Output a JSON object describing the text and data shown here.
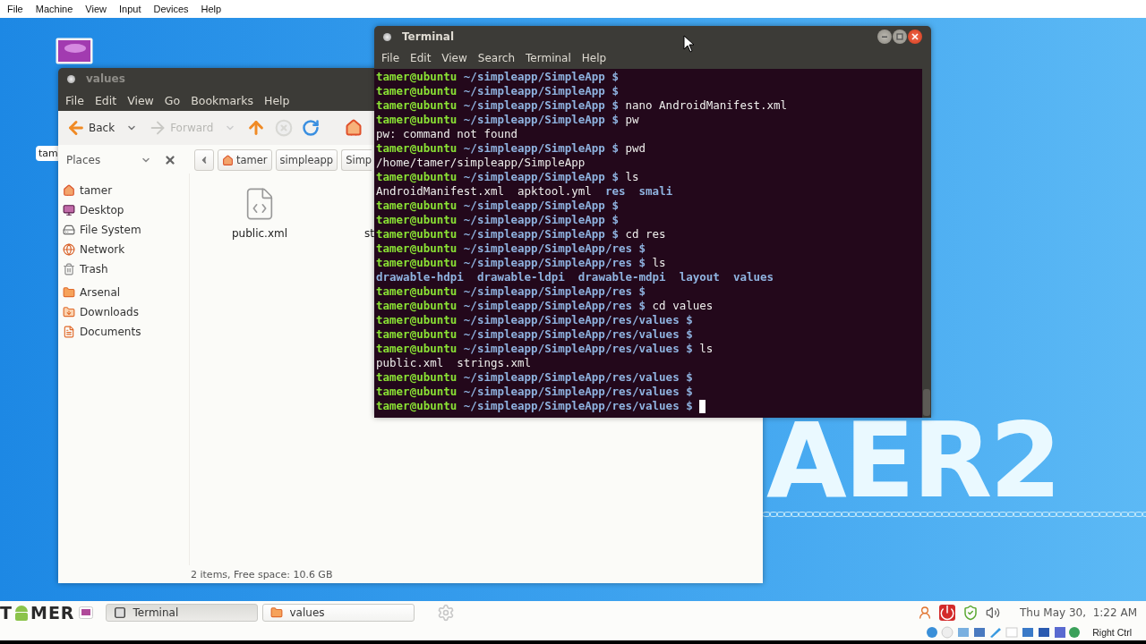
{
  "vm_menu": [
    "File",
    "Machine",
    "View",
    "Input",
    "Devices",
    "Help"
  ],
  "desktop": {
    "icons": [
      {
        "kind": "monitor"
      },
      {
        "kind": "label-only",
        "label": "tam"
      }
    ],
    "wallpaper_text": "AER2"
  },
  "file_manager": {
    "title": "values",
    "menu": [
      "File",
      "Edit",
      "View",
      "Go",
      "Bookmarks",
      "Help"
    ],
    "toolbar": [
      {
        "kind": "back",
        "label": "Back",
        "disabled": false,
        "menu": true
      },
      {
        "kind": "forward",
        "label": "Forward",
        "disabled": true,
        "menu": true
      },
      {
        "kind": "up",
        "disabled": false,
        "menu": false
      },
      {
        "kind": "stop",
        "disabled": true,
        "menu": false
      },
      {
        "kind": "reload",
        "disabled": false,
        "menu": false
      },
      {
        "kind": "home",
        "disabled": false,
        "menu": false
      }
    ],
    "location": {
      "pane": "Places",
      "crumbs": [
        {
          "label": "tamer",
          "kind": "home"
        },
        {
          "label": "simpleapp",
          "kind": "plain"
        },
        {
          "label": "Simp",
          "kind": "plain"
        }
      ]
    },
    "sidebar": {
      "places": [
        {
          "label": "tamer",
          "kind": "home"
        },
        {
          "label": "Desktop",
          "kind": "desktop"
        },
        {
          "label": "File System",
          "kind": "drive"
        },
        {
          "label": "Network",
          "kind": "network"
        },
        {
          "label": "Trash",
          "kind": "trash"
        }
      ],
      "bookmarks": [
        {
          "label": "Arsenal",
          "kind": "folder"
        },
        {
          "label": "Downloads",
          "kind": "downloads"
        },
        {
          "label": "Documents",
          "kind": "documents"
        }
      ]
    },
    "files": [
      {
        "name": "public.xml",
        "kind": "xml"
      },
      {
        "name": "st",
        "kind": "covered"
      }
    ],
    "status": "2 items, Free space: 10.6 GB"
  },
  "terminal": {
    "title": "Terminal",
    "menu": [
      "File",
      "Edit",
      "View",
      "Search",
      "Terminal",
      "Help"
    ],
    "cursor": true,
    "lines": [
      {
        "kind": "prompt",
        "user": "tamer@ubuntu",
        "path": "~/simpleapp/SimpleApp $"
      },
      {
        "kind": "prompt",
        "user": "tamer@ubuntu",
        "path": "~/simpleapp/SimpleApp $"
      },
      {
        "kind": "prompt",
        "user": "tamer@ubuntu",
        "path": "~/simpleapp/SimpleApp $",
        "command": "nano AndroidManifest.xml"
      },
      {
        "kind": "prompt",
        "user": "tamer@ubuntu",
        "path": "~/simpleapp/SimpleApp $",
        "command": "pw"
      },
      {
        "kind": "output",
        "items": [
          {
            "text": "pw: command not found",
            "dir": false
          }
        ]
      },
      {
        "kind": "prompt",
        "user": "tamer@ubuntu",
        "path": "~/simpleapp/SimpleApp $",
        "command": "pwd"
      },
      {
        "kind": "output",
        "items": [
          {
            "text": "/home/tamer/simpleapp/SimpleApp",
            "dir": false
          }
        ]
      },
      {
        "kind": "prompt",
        "user": "tamer@ubuntu",
        "path": "~/simpleapp/SimpleApp $",
        "command": "ls"
      },
      {
        "kind": "output",
        "items": [
          {
            "text": "AndroidManifest.xml",
            "dir": false
          },
          {
            "text": "apktool.yml",
            "dir": false
          },
          {
            "text": "res",
            "dir": true
          },
          {
            "text": "smali",
            "dir": true
          }
        ]
      },
      {
        "kind": "prompt",
        "user": "tamer@ubuntu",
        "path": "~/simpleapp/SimpleApp $"
      },
      {
        "kind": "prompt",
        "user": "tamer@ubuntu",
        "path": "~/simpleapp/SimpleApp $"
      },
      {
        "kind": "prompt",
        "user": "tamer@ubuntu",
        "path": "~/simpleapp/SimpleApp $",
        "command": "cd res"
      },
      {
        "kind": "prompt",
        "user": "tamer@ubuntu",
        "path": "~/simpleapp/SimpleApp/res $"
      },
      {
        "kind": "prompt",
        "user": "tamer@ubuntu",
        "path": "~/simpleapp/SimpleApp/res $",
        "command": "ls"
      },
      {
        "kind": "output",
        "items": [
          {
            "text": "drawable-hdpi",
            "dir": true
          },
          {
            "text": "drawable-ldpi",
            "dir": true
          },
          {
            "text": "drawable-mdpi",
            "dir": true
          },
          {
            "text": "layout",
            "dir": true
          },
          {
            "text": "values",
            "dir": true
          }
        ]
      },
      {
        "kind": "prompt",
        "user": "tamer@ubuntu",
        "path": "~/simpleapp/SimpleApp/res $"
      },
      {
        "kind": "prompt",
        "user": "tamer@ubuntu",
        "path": "~/simpleapp/SimpleApp/res $",
        "command": "cd values"
      },
      {
        "kind": "prompt",
        "user": "tamer@ubuntu",
        "path": "~/simpleapp/SimpleApp/res/values $"
      },
      {
        "kind": "prompt",
        "user": "tamer@ubuntu",
        "path": "~/simpleapp/SimpleApp/res/values $"
      },
      {
        "kind": "prompt",
        "user": "tamer@ubuntu",
        "path": "~/simpleapp/SimpleApp/res/values $",
        "command": "ls"
      },
      {
        "kind": "output",
        "items": [
          {
            "text": "public.xml",
            "dir": false
          },
          {
            "text": "strings.xml",
            "dir": false
          }
        ]
      },
      {
        "kind": "prompt",
        "user": "tamer@ubuntu",
        "path": "~/simpleapp/SimpleApp/res/values $"
      },
      {
        "kind": "prompt",
        "user": "tamer@ubuntu",
        "path": "~/simpleapp/SimpleApp/res/values $"
      },
      {
        "kind": "prompt",
        "user": "tamer@ubuntu",
        "path": "~/simpleapp/SimpleApp/res/values $"
      }
    ]
  },
  "taskbar": {
    "logo": [
      "T",
      "MER"
    ],
    "tasks": [
      {
        "label": "Terminal",
        "kind": "terminal",
        "selected": true
      },
      {
        "label": "values",
        "kind": "folder",
        "selected": false
      }
    ],
    "clock": "Thu May 30,  1:22 AM"
  },
  "vm_status": {
    "host_key": "Right Ctrl"
  }
}
